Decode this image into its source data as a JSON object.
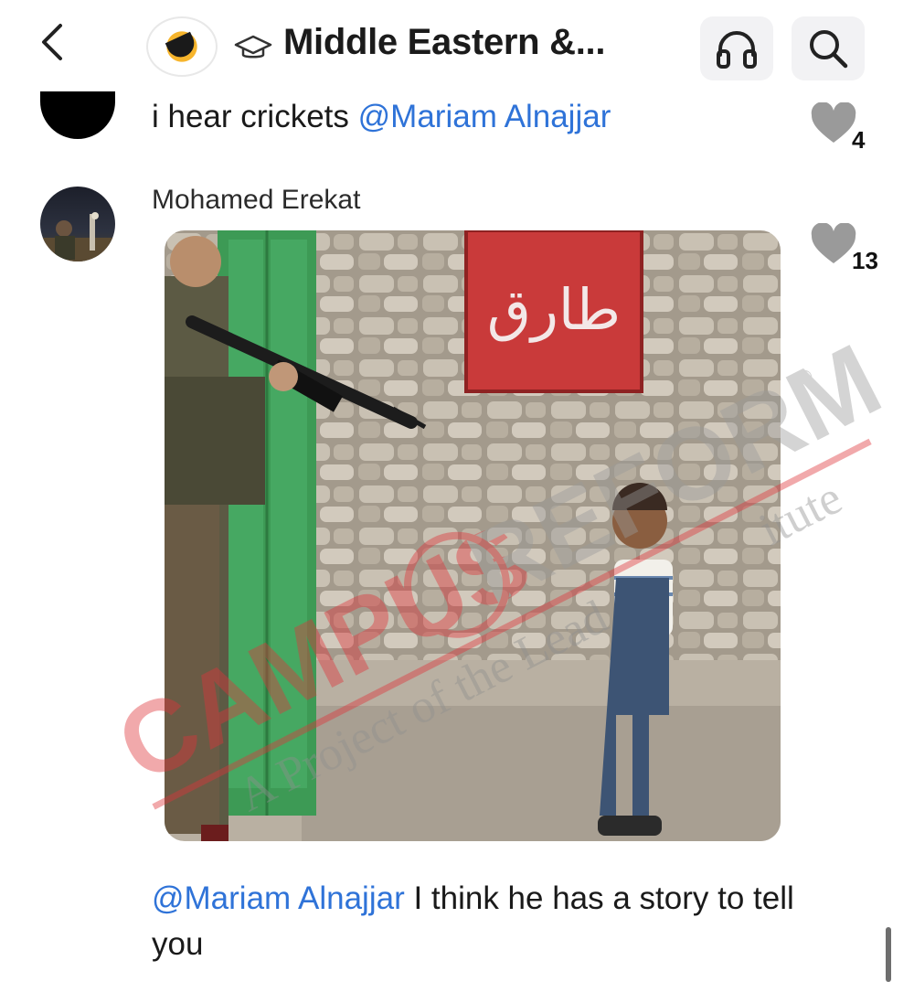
{
  "header": {
    "back_icon": "chevron-left-icon",
    "group_icon": "graduation-cap-icon",
    "title": "Middle Eastern &...",
    "headphones_icon": "headphones-icon",
    "search_icon": "search-icon"
  },
  "comments": [
    {
      "author": "",
      "text": "i hear crickets",
      "mention": "@Mariam Alnajjar",
      "likes": "4"
    },
    {
      "author": "Mohamed Erekat",
      "mention": "@Mariam Alnajjar",
      "text": " I think he has a story to tell you",
      "likes": "13"
    }
  ],
  "photo": {
    "wall_graffiti": "طارق"
  },
  "watermark": {
    "main": "CAMPUS",
    "brand": "REFORM",
    "registered": "®",
    "tagline": "A Project of the Lead",
    "tagline_tail": "itute"
  },
  "colors": {
    "mention": "#2f73d8",
    "heart": "#9a9a9a",
    "watermark": "#e0343a"
  }
}
